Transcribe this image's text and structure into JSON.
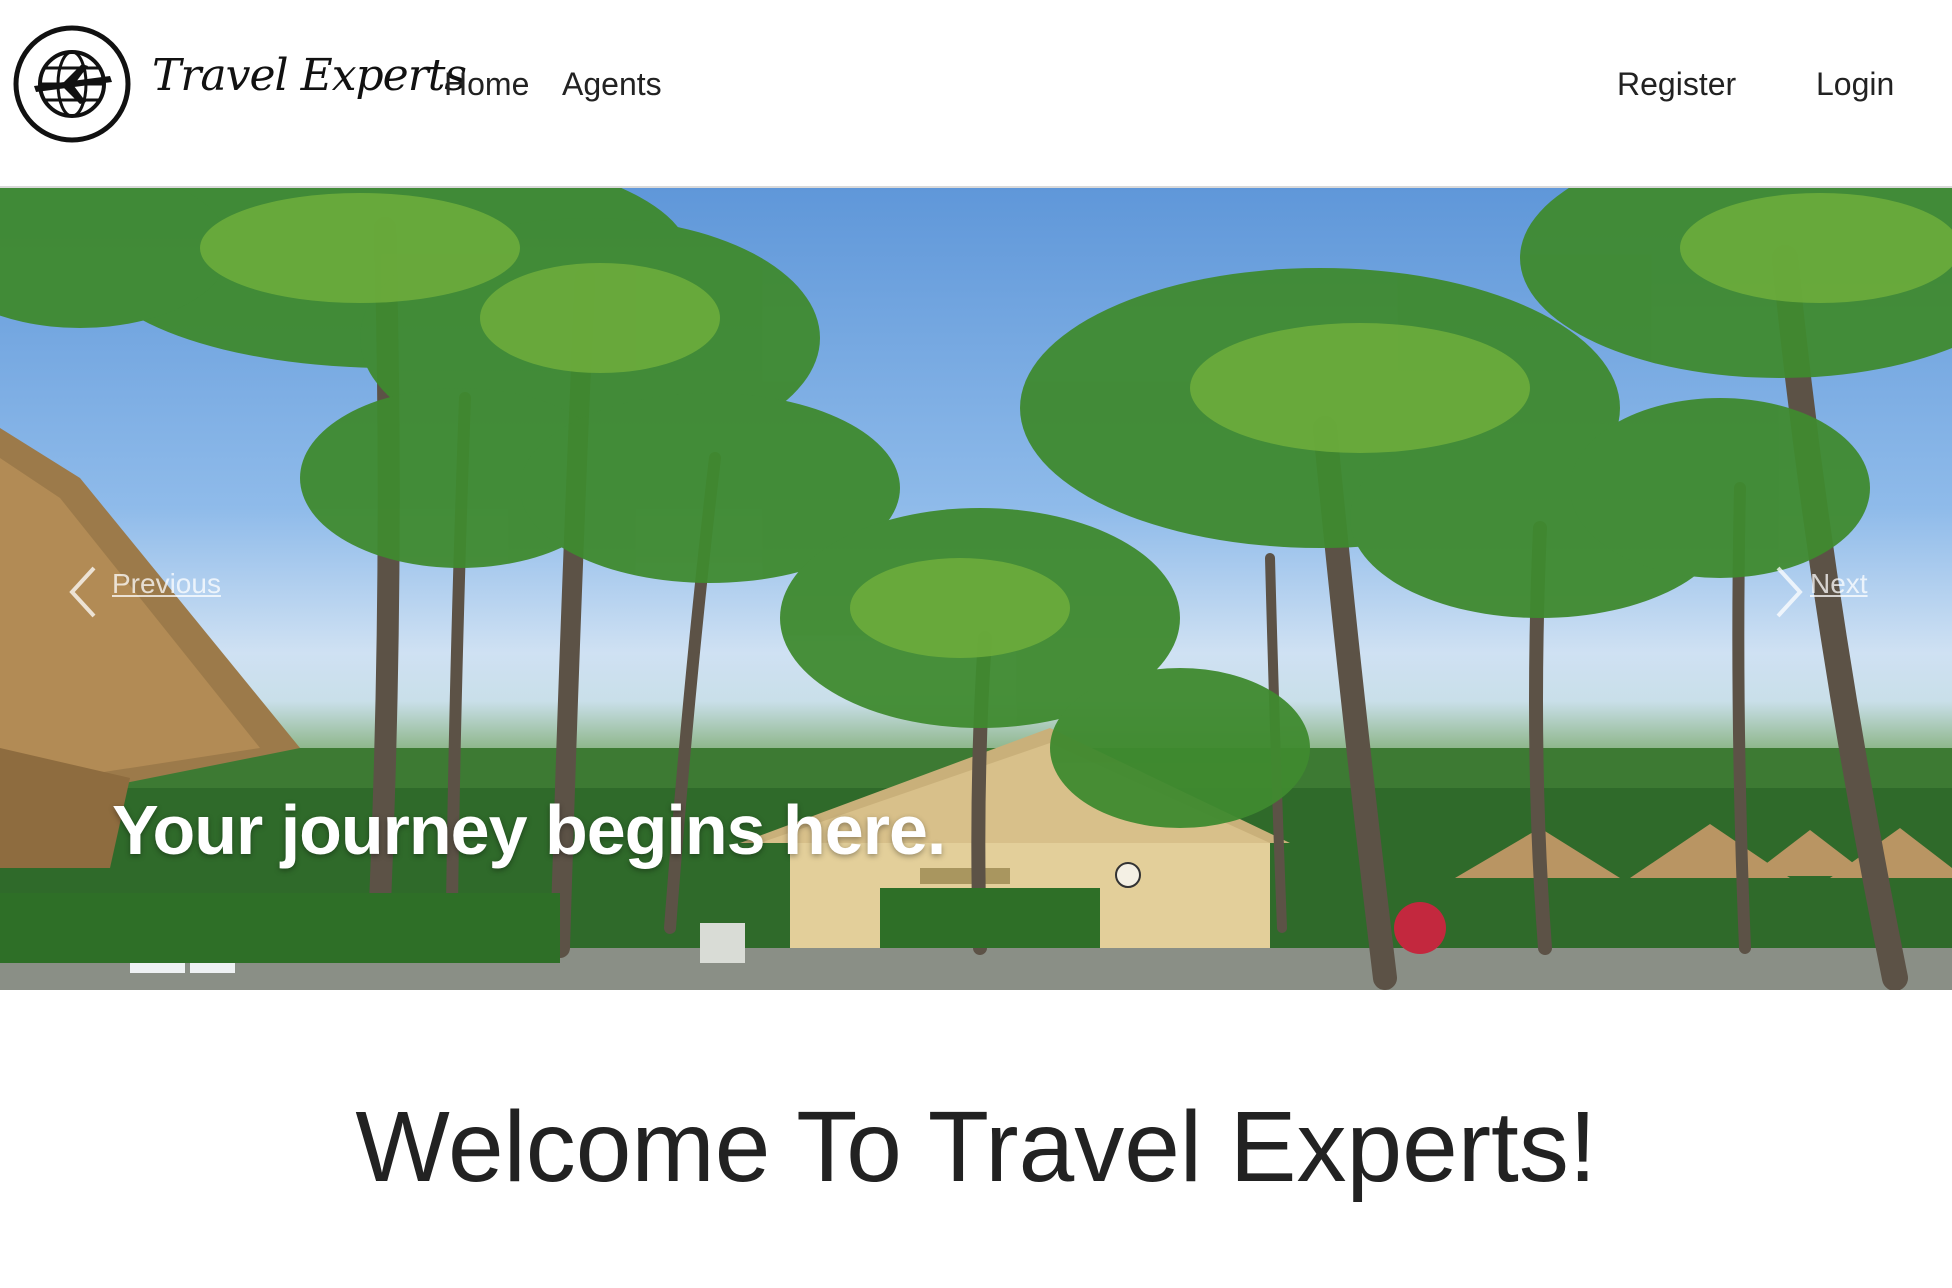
{
  "brand": {
    "name": "Travel Experts",
    "logo_icon": "globe-airplane-icon"
  },
  "nav": {
    "home": "Home",
    "agents": "Agents",
    "register": "Register",
    "login": "Login"
  },
  "carousel": {
    "prev_label": "Previous",
    "next_label": "Next",
    "prev_icon": "chevron-left-icon",
    "next_icon": "chevron-right-icon",
    "caption": "Your journey begins here.",
    "slide_image": "tropical-resort-palm-trees"
  },
  "main": {
    "heading": "Welcome To Travel Experts!"
  },
  "colors": {
    "text": "#212529",
    "caption": "#ffffff",
    "sky": "#5f97d9"
  }
}
